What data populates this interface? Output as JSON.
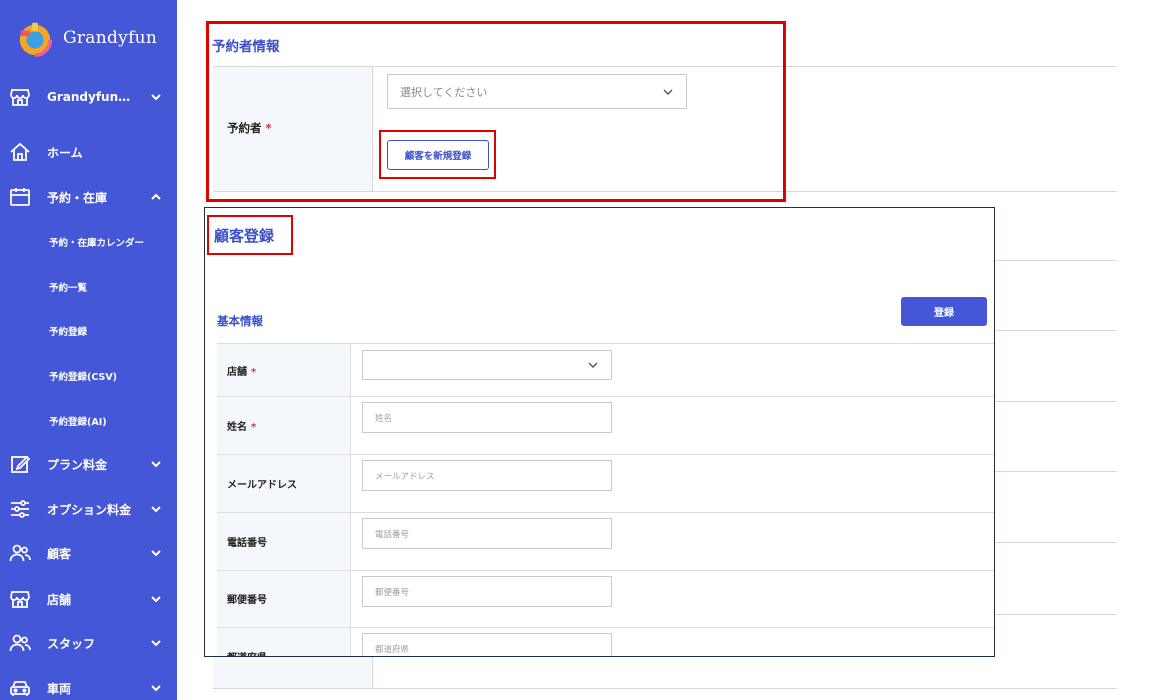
{
  "brand": {
    "name": "Grandyfun"
  },
  "sidebar": {
    "items": [
      {
        "label": "Grandyfun…",
        "icon": "store-icon",
        "chevron": "down"
      },
      {
        "label": "ホーム",
        "icon": "home-icon",
        "chevron": ""
      },
      {
        "label": "予約・在庫",
        "icon": "calendar-icon",
        "chevron": "up"
      },
      {
        "label": "プラン料金",
        "icon": "edit-icon",
        "chevron": "down"
      },
      {
        "label": "オプション料金",
        "icon": "sliders-icon",
        "chevron": "down"
      },
      {
        "label": "顧客",
        "icon": "users-icon",
        "chevron": "down"
      },
      {
        "label": "店舗",
        "icon": "store-icon",
        "chevron": "down"
      },
      {
        "label": "スタッフ",
        "icon": "users-icon",
        "chevron": "down"
      },
      {
        "label": "車両",
        "icon": "car-icon",
        "chevron": "down"
      }
    ],
    "subitems": [
      {
        "label": "予約・在庫カレンダー"
      },
      {
        "label": "予約一覧"
      },
      {
        "label": "予約登録"
      },
      {
        "label": "予約登録(CSV)"
      },
      {
        "label": "予約登録(AI)"
      }
    ]
  },
  "reservation": {
    "section_title": "予約者情報",
    "booker_label": "予約者",
    "required_mark": "*",
    "select_placeholder": "選択してください",
    "new_customer_button": "顧客を新規登録"
  },
  "modal": {
    "title": "顧客登録",
    "section_title": "基本情報",
    "submit_button": "登録",
    "fields": [
      {
        "label": "店舗",
        "required": "*",
        "placeholder": ""
      },
      {
        "label": "姓名",
        "required": "*",
        "placeholder": "姓名"
      },
      {
        "label": "メールアドレス",
        "required": "",
        "placeholder": "メールアドレス"
      },
      {
        "label": "電話番号",
        "required": "",
        "placeholder": "電話番号"
      },
      {
        "label": "郵便番号",
        "required": "",
        "placeholder": "郵便番号"
      },
      {
        "label": "都道府県",
        "required": "",
        "placeholder": "都道府県"
      }
    ]
  },
  "colors": {
    "sidebar_bg": "#4457d6",
    "accent": "#3a4fc9",
    "highlight": "#e00000",
    "required": "#e03030"
  }
}
